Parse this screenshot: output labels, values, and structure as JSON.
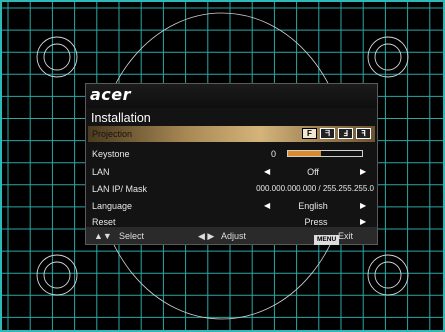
{
  "brand": "acer",
  "menu": {
    "title": "Installation",
    "rows": [
      {
        "label": "Projection",
        "modes": [
          "F",
          "R",
          "F",
          "R"
        ],
        "active_mode": 0
      },
      {
        "label": "Keystone",
        "value": "0",
        "keystone_level": 0.45
      },
      {
        "label": "LAN",
        "value": "Off"
      },
      {
        "label": "LAN IP/ Mask",
        "value": "000.000.000.000 / 255.255.255.0"
      },
      {
        "label": "Language",
        "value": "English"
      },
      {
        "label": "Reset",
        "value": "Press"
      }
    ]
  },
  "footer": {
    "select": "Select",
    "adjust": "Adjust",
    "menu_key": "MENU",
    "exit": "Exit"
  },
  "colors": {
    "grid": "#2fb8b8",
    "highlight": "#c9a76d",
    "keystone_fill": "#d98a2a"
  }
}
